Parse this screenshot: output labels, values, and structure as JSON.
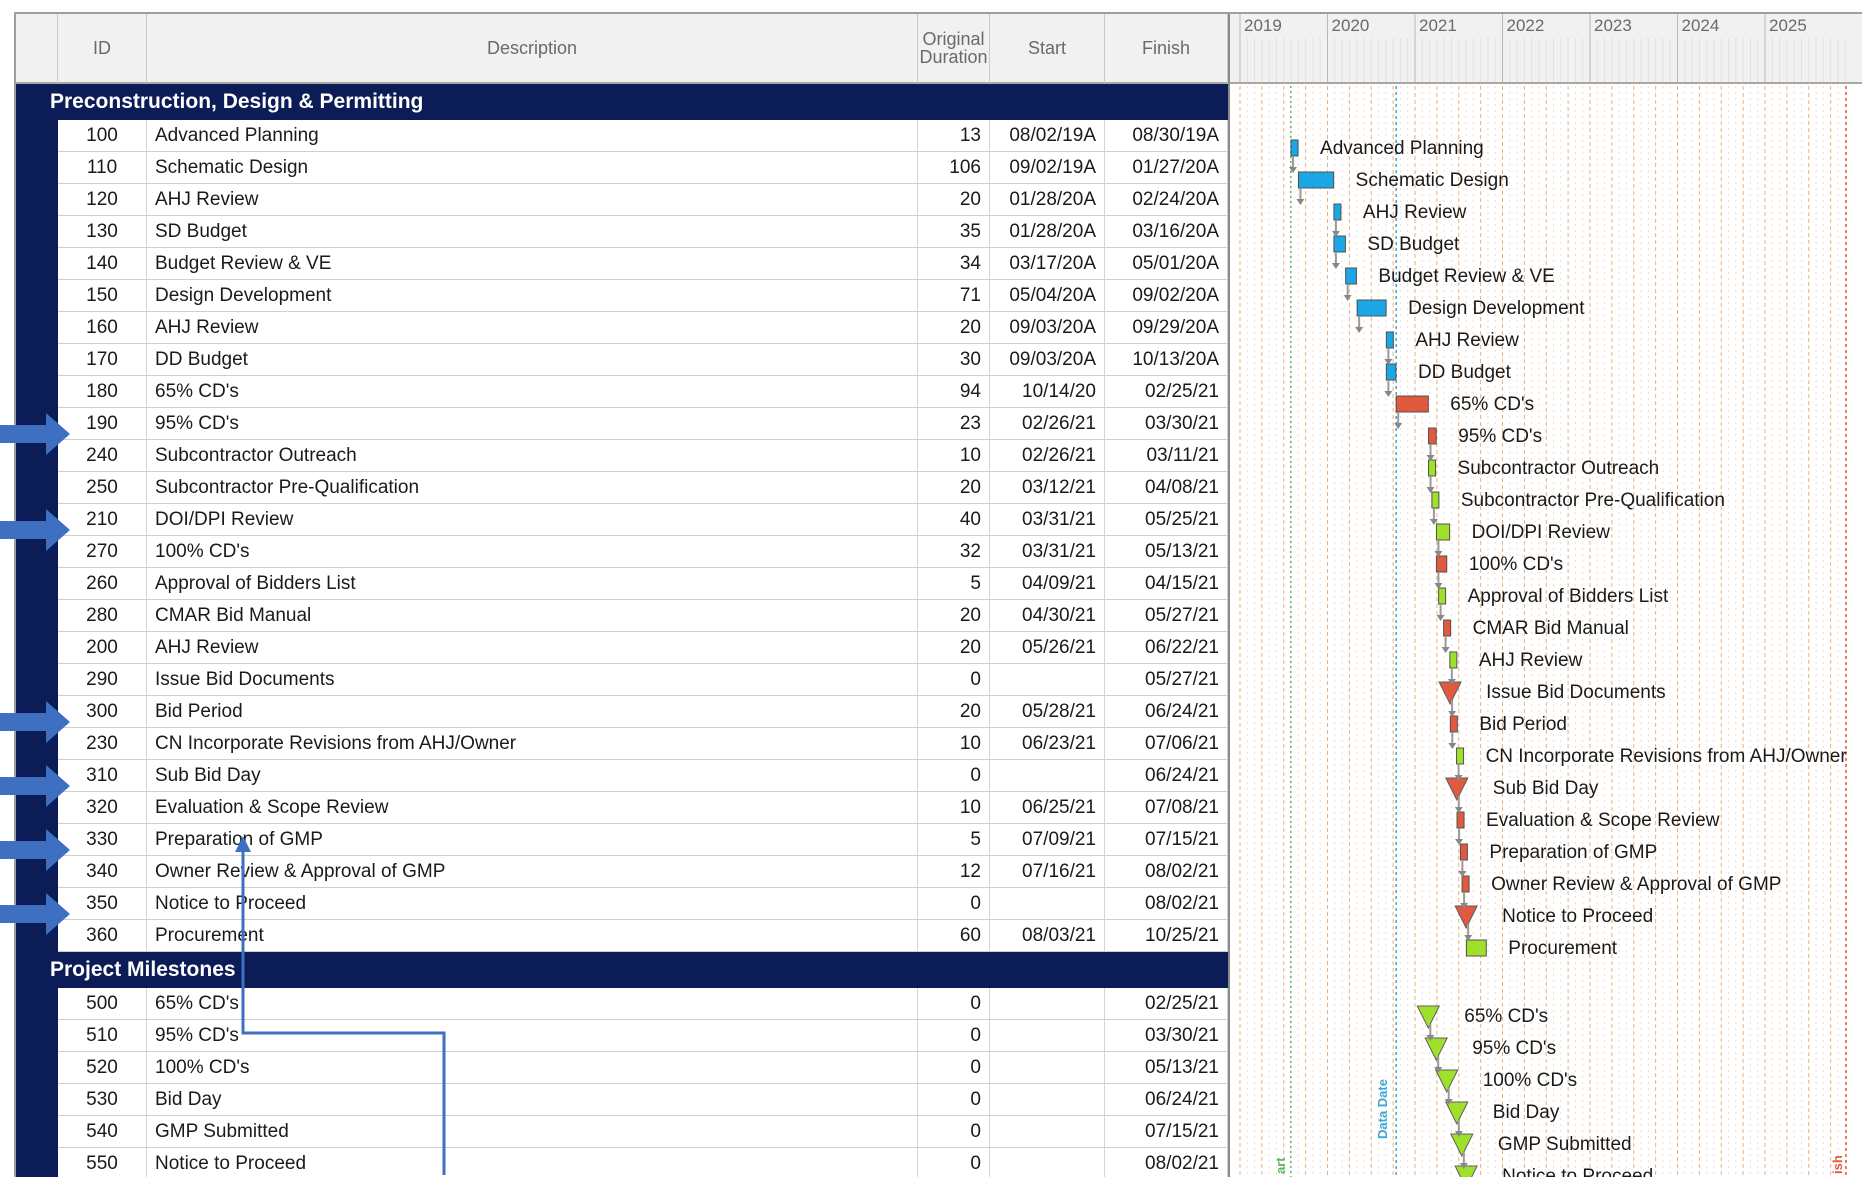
{
  "columns": {
    "id": "ID",
    "description": "Description",
    "duration_line1": "Original",
    "duration_line2": "Duration",
    "start": "Start",
    "finish": "Finish"
  },
  "years": [
    "2019",
    "2020",
    "2021",
    "2022",
    "2023",
    "2024",
    "2025"
  ],
  "sections": [
    {
      "title": "Preconstruction, Design & Permitting",
      "rows": [
        {
          "id": "100",
          "desc": "Advanced Planning",
          "dur": "13",
          "start": "08/02/19A",
          "finish": "08/30/19A",
          "kind": "blue",
          "s": "2019-08-02",
          "f": "2019-08-30"
        },
        {
          "id": "110",
          "desc": "Schematic Design",
          "dur": "106",
          "start": "09/02/19A",
          "finish": "01/27/20A",
          "kind": "blue",
          "s": "2019-09-02",
          "f": "2020-01-27"
        },
        {
          "id": "120",
          "desc": "AHJ Review",
          "dur": "20",
          "start": "01/28/20A",
          "finish": "02/24/20A",
          "kind": "blue",
          "s": "2020-01-28",
          "f": "2020-02-24"
        },
        {
          "id": "130",
          "desc": "SD Budget",
          "dur": "35",
          "start": "01/28/20A",
          "finish": "03/16/20A",
          "kind": "blue",
          "s": "2020-01-28",
          "f": "2020-03-16"
        },
        {
          "id": "140",
          "desc": "Budget Review & VE",
          "dur": "34",
          "start": "03/17/20A",
          "finish": "05/01/20A",
          "kind": "blue",
          "s": "2020-03-17",
          "f": "2020-05-01"
        },
        {
          "id": "150",
          "desc": "Design Development",
          "dur": "71",
          "start": "05/04/20A",
          "finish": "09/02/20A",
          "kind": "blue",
          "s": "2020-05-04",
          "f": "2020-09-02"
        },
        {
          "id": "160",
          "desc": "AHJ Review",
          "dur": "20",
          "start": "09/03/20A",
          "finish": "09/29/20A",
          "kind": "blue",
          "s": "2020-09-03",
          "f": "2020-09-29"
        },
        {
          "id": "170",
          "desc": "DD Budget",
          "dur": "30",
          "start": "09/03/20A",
          "finish": "10/13/20A",
          "kind": "blue",
          "s": "2020-09-03",
          "f": "2020-10-13"
        },
        {
          "id": "180",
          "desc": "65% CD's",
          "dur": "94",
          "start": "10/14/20",
          "finish": "02/25/21",
          "kind": "red",
          "s": "2020-10-14",
          "f": "2021-02-25"
        },
        {
          "id": "190",
          "desc": "95% CD's",
          "dur": "23",
          "start": "02/26/21",
          "finish": "03/30/21",
          "kind": "red",
          "s": "2021-02-26",
          "f": "2021-03-30",
          "arrow": true
        },
        {
          "id": "240",
          "desc": "Subcontractor Outreach",
          "dur": "10",
          "start": "02/26/21",
          "finish": "03/11/21",
          "kind": "green",
          "s": "2021-02-26",
          "f": "2021-03-11"
        },
        {
          "id": "250",
          "desc": "Subcontractor Pre-Qualification",
          "dur": "20",
          "start": "03/12/21",
          "finish": "04/08/21",
          "kind": "green",
          "s": "2021-03-12",
          "f": "2021-04-08"
        },
        {
          "id": "210",
          "desc": "DOI/DPI Review",
          "dur": "40",
          "start": "03/31/21",
          "finish": "05/25/21",
          "kind": "green",
          "s": "2021-03-31",
          "f": "2021-05-25",
          "arrow": true
        },
        {
          "id": "270",
          "desc": "100% CD's",
          "dur": "32",
          "start": "03/31/21",
          "finish": "05/13/21",
          "kind": "red",
          "s": "2021-03-31",
          "f": "2021-05-13"
        },
        {
          "id": "260",
          "desc": "Approval of Bidders List",
          "dur": "5",
          "start": "04/09/21",
          "finish": "04/15/21",
          "kind": "green",
          "s": "2021-04-09",
          "f": "2021-04-15"
        },
        {
          "id": "280",
          "desc": "CMAR Bid Manual",
          "dur": "20",
          "start": "04/30/21",
          "finish": "05/27/21",
          "kind": "red",
          "s": "2021-04-30",
          "f": "2021-05-27"
        },
        {
          "id": "200",
          "desc": "AHJ Review",
          "dur": "20",
          "start": "05/26/21",
          "finish": "06/22/21",
          "kind": "green",
          "s": "2021-05-26",
          "f": "2021-06-22"
        },
        {
          "id": "290",
          "desc": "Issue Bid Documents",
          "dur": "0",
          "start": "",
          "finish": "05/27/21",
          "kind": "ms-red",
          "s": "2021-05-27",
          "f": "2021-05-27"
        },
        {
          "id": "300",
          "desc": "Bid Period",
          "dur": "20",
          "start": "05/28/21",
          "finish": "06/24/21",
          "kind": "red",
          "s": "2021-05-28",
          "f": "2021-06-24",
          "arrow": true
        },
        {
          "id": "230",
          "desc": "CN Incorporate Revisions from AHJ/Owner",
          "dur": "10",
          "start": "06/23/21",
          "finish": "07/06/21",
          "kind": "green",
          "s": "2021-06-23",
          "f": "2021-07-06"
        },
        {
          "id": "310",
          "desc": "Sub Bid Day",
          "dur": "0",
          "start": "",
          "finish": "06/24/21",
          "kind": "ms-red",
          "s": "2021-06-24",
          "f": "2021-06-24",
          "arrow": true
        },
        {
          "id": "320",
          "desc": "Evaluation & Scope Review",
          "dur": "10",
          "start": "06/25/21",
          "finish": "07/08/21",
          "kind": "red",
          "s": "2021-06-25",
          "f": "2021-07-08"
        },
        {
          "id": "330",
          "desc": "Preparation of GMP",
          "dur": "5",
          "start": "07/09/21",
          "finish": "07/15/21",
          "kind": "red",
          "s": "2021-07-09",
          "f": "2021-07-15",
          "arrow": true
        },
        {
          "id": "340",
          "desc": "Owner Review & Approval of GMP",
          "dur": "12",
          "start": "07/16/21",
          "finish": "08/02/21",
          "kind": "red",
          "s": "2021-07-16",
          "f": "2021-08-02"
        },
        {
          "id": "350",
          "desc": "Notice to Proceed",
          "dur": "0",
          "start": "",
          "finish": "08/02/21",
          "kind": "ms-red",
          "s": "2021-08-02",
          "f": "2021-08-02",
          "arrow": true
        },
        {
          "id": "360",
          "desc": "Procurement",
          "dur": "60",
          "start": "08/03/21",
          "finish": "10/25/21",
          "kind": "green",
          "s": "2021-08-03",
          "f": "2021-10-25"
        }
      ]
    },
    {
      "title": "Project Milestones",
      "rows": [
        {
          "id": "500",
          "desc": "65% CD's",
          "dur": "0",
          "start": "",
          "finish": "02/25/21",
          "kind": "ms-green",
          "s": "2021-02-25",
          "f": "2021-02-25"
        },
        {
          "id": "510",
          "desc": "95% CD's",
          "dur": "0",
          "start": "",
          "finish": "03/30/21",
          "kind": "ms-green",
          "s": "2021-03-30",
          "f": "2021-03-30"
        },
        {
          "id": "520",
          "desc": "100% CD's",
          "dur": "0",
          "start": "",
          "finish": "05/13/21",
          "kind": "ms-green",
          "s": "2021-05-13",
          "f": "2021-05-13"
        },
        {
          "id": "530",
          "desc": "Bid Day",
          "dur": "0",
          "start": "",
          "finish": "06/24/21",
          "kind": "ms-green",
          "s": "2021-06-24",
          "f": "2021-06-24"
        },
        {
          "id": "540",
          "desc": "GMP Submitted",
          "dur": "0",
          "start": "",
          "finish": "07/15/21",
          "kind": "ms-green",
          "s": "2021-07-15",
          "f": "2021-07-15"
        },
        {
          "id": "550",
          "desc": "Notice to Proceed",
          "dur": "0",
          "start": "",
          "finish": "08/02/21",
          "kind": "ms-green",
          "s": "2021-08-02",
          "f": "2021-08-02"
        }
      ]
    }
  ],
  "gantt": {
    "data_date_label": "Data Date",
    "data_date": "2020-10-14",
    "start_label": "art",
    "finish_label": "ish"
  },
  "colors": {
    "band": "#0c1c57",
    "blue_bar": "#1ba7e6",
    "red_bar": "#e05a40",
    "green_bar": "#9fe02a",
    "data_date_line": "#3aa7d6",
    "annotation_arrow": "#3f6fc0"
  }
}
